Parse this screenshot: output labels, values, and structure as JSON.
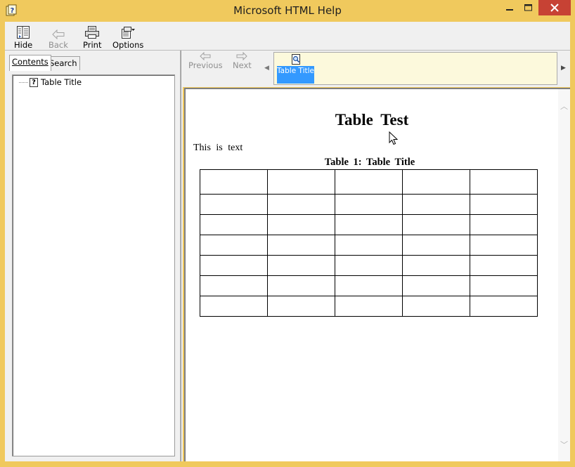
{
  "window": {
    "title": "Microsoft HTML Help",
    "controls": {
      "minimize_icon": "minimize-icon",
      "maximize_icon": "maximize-icon",
      "close_icon": "close-icon"
    }
  },
  "toolbar": {
    "hide_label": "Hide",
    "back_label": "Back",
    "print_label": "Print",
    "options_label": "Options"
  },
  "nav": {
    "tabs": [
      {
        "label": "Contents",
        "selected": true
      },
      {
        "label": "Search",
        "selected": false
      }
    ],
    "tree": [
      {
        "label": "Table Title"
      }
    ]
  },
  "topic_bar": {
    "previous_label": "Previous",
    "next_label": "Next",
    "history": [
      {
        "label": "Table Title",
        "selected": true
      }
    ]
  },
  "document": {
    "heading": "Table Test",
    "paragraph": "This is text",
    "table_caption": "Table 1: Table Title",
    "table": {
      "rows": 7,
      "columns": 5
    }
  },
  "colors": {
    "frame": "#f0c95d",
    "close_button": "#c74234",
    "selection": "#3399ff",
    "history_background": "#fcf9dc"
  }
}
